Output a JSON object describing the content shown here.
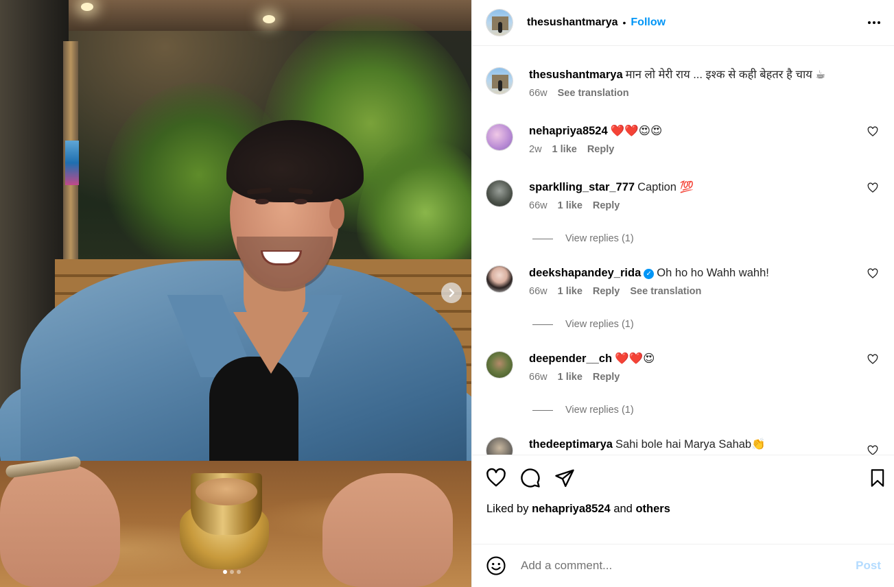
{
  "post": {
    "username": "thesushantmarya",
    "separator": "•",
    "follow_label": "Follow",
    "caption": {
      "username": "thesushantmarya",
      "text": "मान लो मेरी राय ... इश्क से कही बेहतर है चाय ☕",
      "time": "66w",
      "see_translation": "See translation"
    },
    "carousel": {
      "total": 3,
      "active": 1
    }
  },
  "comments": [
    {
      "username": "nehapriya8524",
      "text": "❤️❤️😍😍",
      "time": "2w",
      "likes": "1 like",
      "reply": "Reply",
      "verified": false,
      "see_translation": ""
    },
    {
      "username": "sparklling_star_777",
      "text": "Caption 💯",
      "time": "66w",
      "likes": "1 like",
      "reply": "Reply",
      "verified": false,
      "view_replies": "View replies (1)"
    },
    {
      "username": "deekshapandey_rida",
      "text": "Oh ho ho Wahh wahh!",
      "time": "66w",
      "likes": "1 like",
      "reply": "Reply",
      "verified": true,
      "see_translation": "See translation",
      "view_replies": "View replies (1)"
    },
    {
      "username": "deepender__ch",
      "text": "❤️❤️😍",
      "time": "66w",
      "likes": "1 like",
      "reply": "Reply",
      "verified": false,
      "view_replies": "View replies (1)"
    },
    {
      "username": "thedeeptimarya",
      "text": "Sahi bole hai Marya Sahab👏",
      "verified": false
    }
  ],
  "likes": {
    "prefix": "Liked by",
    "user": "nehapriya8524",
    "and": "and",
    "others": "others"
  },
  "comment_box": {
    "placeholder": "Add a comment...",
    "post_label": "Post"
  },
  "colors": {
    "accent": "#0095f6",
    "muted": "#737373",
    "post_disabled": "#b3dbff"
  }
}
